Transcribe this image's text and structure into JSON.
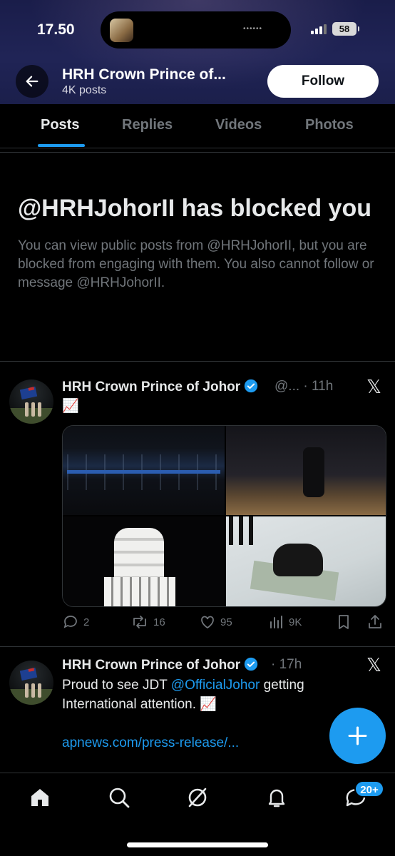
{
  "status_bar": {
    "time": "17.50",
    "battery": "58"
  },
  "header": {
    "title": "HRH Crown Prince of...",
    "subtitle": "4K posts",
    "follow_label": "Follow"
  },
  "tabs": [
    {
      "label": "Posts",
      "active": true
    },
    {
      "label": "Replies",
      "active": false
    },
    {
      "label": "Videos",
      "active": false
    },
    {
      "label": "Photos",
      "active": false
    }
  ],
  "blocked": {
    "title": "@HRHJohorII has blocked you",
    "text": "You can view public posts from @HRHJohorII, but you are blocked from engaging with them. You also cannot follow or message @HRHJohorII."
  },
  "posts": [
    {
      "author": "HRH Crown Prince of Johor",
      "handle": "@...",
      "time": "· 11h",
      "text": "📈",
      "actions": {
        "replies": "2",
        "reposts": "16",
        "likes": "95",
        "views": "9K"
      }
    },
    {
      "author": "HRH Crown Prince of Johor",
      "time": "· 17h",
      "text_before": "Proud to see JDT ",
      "mention": "@OfficialJohor",
      "text_after": " getting International attention. 📈",
      "link": "apnews.com/press-release/..."
    }
  ],
  "bottom_nav": {
    "notification_badge": "20+"
  },
  "colors": {
    "accent": "#1d9bf0",
    "background": "#000000",
    "muted": "#71767b"
  }
}
